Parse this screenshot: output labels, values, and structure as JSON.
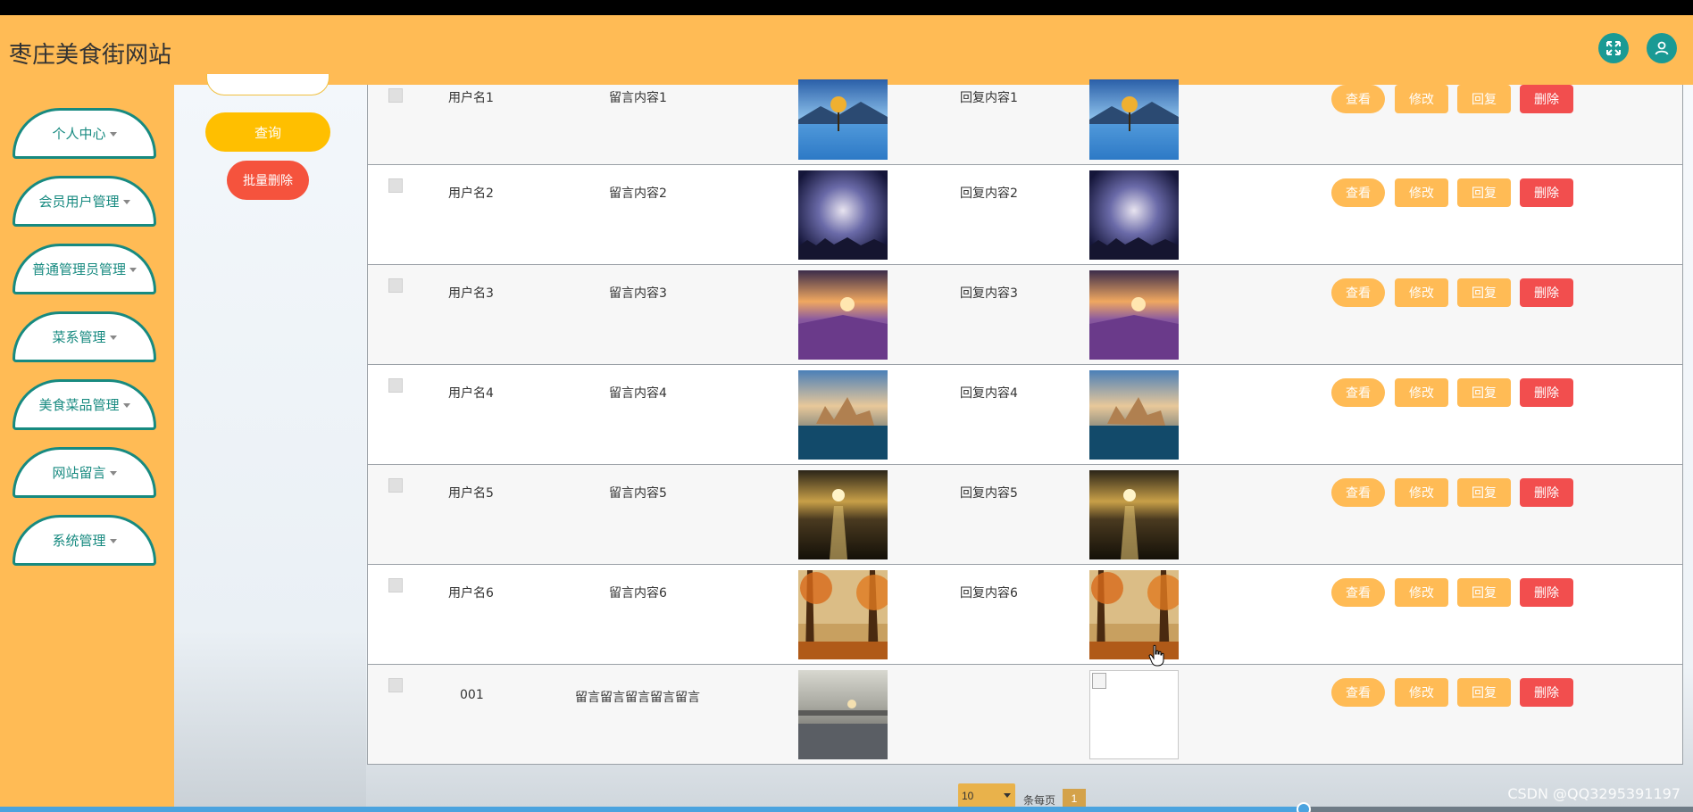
{
  "header": {
    "site_title": "枣庄美食街网站",
    "icons": [
      "fullscreen-icon",
      "user-icon"
    ]
  },
  "sidebar": {
    "items": [
      {
        "label": "个人中心"
      },
      {
        "label": "会员用户管理"
      },
      {
        "label": "普通管理员管理"
      },
      {
        "label": "菜系管理"
      },
      {
        "label": "美食菜品管理"
      },
      {
        "label": "网站留言"
      },
      {
        "label": "系统管理"
      }
    ]
  },
  "toolbar": {
    "query_label": "查询",
    "batch_delete_label": "批量删除"
  },
  "table": {
    "rows": [
      {
        "username": "用户名1",
        "message": "留言内容1",
        "reply": "回复内容1",
        "image": "lake-tree"
      },
      {
        "username": "用户名2",
        "message": "留言内容2",
        "reply": "回复内容2",
        "image": "night-sky"
      },
      {
        "username": "用户名3",
        "message": "留言内容3",
        "reply": "回复内容3",
        "image": "lavender-field"
      },
      {
        "username": "用户名4",
        "message": "留言内容4",
        "reply": "回复内容4",
        "image": "castle-island"
      },
      {
        "username": "用户名5",
        "message": "留言内容5",
        "reply": "回复内容5",
        "image": "sunset-sea"
      },
      {
        "username": "用户名6",
        "message": "留言内容6",
        "reply": "回复内容6",
        "image": "autumn-forest"
      },
      {
        "username": "001",
        "message": "留言留言留言留言留言",
        "reply": "",
        "image": "city-river"
      }
    ],
    "actions": {
      "view": "查看",
      "edit": "修改",
      "reply": "回复",
      "delete": "删除"
    }
  },
  "pagination": {
    "page_size": "10",
    "per_page_label": "条每页",
    "current_page": "1"
  },
  "video": {
    "progress": 0.77
  },
  "watermark": "CSDN @QQ3295391197",
  "colors": {
    "header": "#FFBB55",
    "accent_teal": "#178a80",
    "query": "#FFBF00",
    "danger": "#F24E4E"
  }
}
